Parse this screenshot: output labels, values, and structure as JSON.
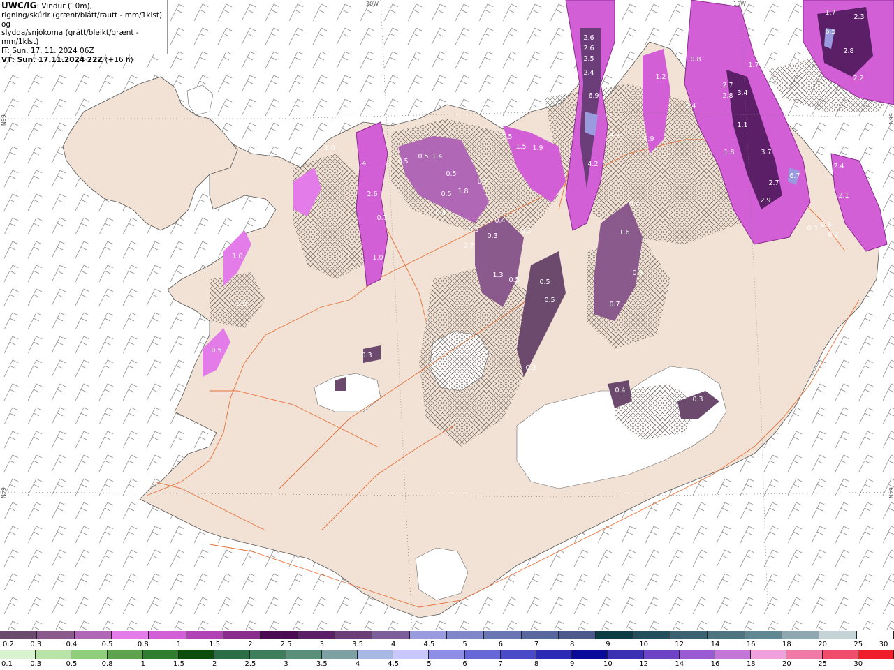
{
  "header": {
    "product_code": "UWC/IG",
    "desc_line1": ": Vindur (10m),",
    "desc_line2": "rigning/skúrir (grænt/blátt/rautt - mm/1klst) og",
    "desc_line3": "slydda/snjókoma (grátt/bleikt/grænt - mm/1klst)",
    "issue_time": "IT: Sun. 17. 11. 2024 06Z",
    "valid_time": "VT: Sun. 17.11.2024 22Z",
    "lead_time": "(+16 h)"
  },
  "graticule": {
    "lon_20w": "20W",
    "lon_15w": "15W",
    "lat_66n_left": "66N",
    "lat_66n_right": "66N",
    "lat_64n_left": "64N",
    "lat_64n_right": "64N"
  },
  "precip_labels": [
    {
      "v": "2.6"
    },
    {
      "v": "2.6"
    },
    {
      "v": "2.5"
    },
    {
      "v": "2.4"
    },
    {
      "v": "6.9"
    },
    {
      "v": "4.7"
    },
    {
      "v": "4.2"
    },
    {
      "v": "1.2"
    },
    {
      "v": "1.2"
    },
    {
      "v": "0.4"
    },
    {
      "v": "0.9"
    },
    {
      "v": "0.8"
    },
    {
      "v": "2.4"
    },
    {
      "v": "2.7"
    },
    {
      "v": "3.4"
    },
    {
      "v": "2.8"
    },
    {
      "v": "1.7"
    },
    {
      "v": "1.1"
    },
    {
      "v": "1.8"
    },
    {
      "v": "3.7"
    },
    {
      "v": "2.7"
    },
    {
      "v": "6.7"
    },
    {
      "v": "2.9"
    },
    {
      "v": "2.4"
    },
    {
      "v": "2.1"
    },
    {
      "v": "0.3"
    },
    {
      "v": "0.3"
    },
    {
      "v": "0.2"
    },
    {
      "v": "1.7"
    },
    {
      "v": "6.5"
    },
    {
      "v": "2.8"
    },
    {
      "v": "2.3"
    },
    {
      "v": "2.2"
    },
    {
      "v": "1.0"
    },
    {
      "v": "1.4"
    },
    {
      "v": "2.6"
    },
    {
      "v": "0.7"
    },
    {
      "v": "1.0"
    },
    {
      "v": "0.5"
    },
    {
      "v": "1.4"
    },
    {
      "v": "0.5"
    },
    {
      "v": "0.5"
    },
    {
      "v": "0.5"
    },
    {
      "v": "0.4"
    },
    {
      "v": "1.8"
    },
    {
      "v": "0.7"
    },
    {
      "v": "1.5"
    },
    {
      "v": "1.5"
    },
    {
      "v": "1.9"
    },
    {
      "v": "0.4"
    },
    {
      "v": "0.5"
    },
    {
      "v": "0.3"
    },
    {
      "v": "0.5"
    },
    {
      "v": "0.7"
    },
    {
      "v": "0.4"
    },
    {
      "v": "1.6"
    },
    {
      "v": "1.3"
    },
    {
      "v": "0.5"
    },
    {
      "v": "0.5"
    },
    {
      "v": "0.5"
    },
    {
      "v": "0.9"
    },
    {
      "v": "0.7"
    },
    {
      "v": "0.3"
    },
    {
      "v": "0.5"
    },
    {
      "v": "1.0"
    },
    {
      "v": "0.3"
    },
    {
      "v": "0.6"
    },
    {
      "v": "0.4"
    },
    {
      "v": "0.3"
    },
    {
      "v": "0"
    }
  ],
  "legend_snow": {
    "colors": [
      "#6b4a6e",
      "#8a5a8c",
      "#b067b5",
      "#e37be9",
      "#d25fd6",
      "#b142b6",
      "#8a2b8e",
      "#4a0b52",
      "#5a1f66",
      "#6b3e7a",
      "#7c5f9a",
      "#9a9ade",
      "#7f87c9",
      "#6a75b4",
      "#59679f",
      "#4c5b8c",
      "#0c3b44",
      "#234f5c",
      "#3a6270",
      "#4e7480",
      "#5f8892",
      "#8fa7b0",
      "#c3d3d6",
      "#ffffff"
    ],
    "labels": [
      "0.2",
      "0.3",
      "0.4",
      "0.5",
      "0.8",
      "1",
      "1.5",
      "2",
      "2.5",
      "3",
      "3.5",
      "4",
      "4.5",
      "5",
      "6",
      "7",
      "8",
      "9",
      "10",
      "12",
      "14",
      "16",
      "18",
      "20",
      "25",
      "30"
    ]
  },
  "legend_rain": {
    "colors": [
      "#d9f2cf",
      "#b9e4a8",
      "#8fcf7b",
      "#5ea24e",
      "#2f7d2f",
      "#0c4d0c",
      "#2b6d45",
      "#3f7e5d",
      "#5a8f7a",
      "#7da1a3",
      "#a8b8e4",
      "#c8c8ff",
      "#8e8ee6",
      "#6767d8",
      "#4a4ac9",
      "#2a2ab5",
      "#0a0a9a",
      "#3b2fb3",
      "#6e44c6",
      "#9a5ad2",
      "#c475d8",
      "#f0a0dc",
      "#f07aa5",
      "#f04c6b",
      "#f01e2a"
    ],
    "labels": [
      "0.1",
      "0.3",
      "0.5",
      "0.8",
      "1",
      "1.5",
      "2",
      "2.5",
      "3",
      "3.5",
      "4",
      "4.5",
      "5",
      "6",
      "7",
      "8",
      "9",
      "10",
      "12",
      "14",
      "16",
      "18",
      "20",
      "25",
      "30"
    ]
  }
}
